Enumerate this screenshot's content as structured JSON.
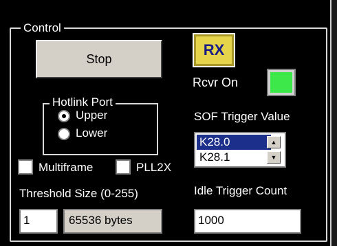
{
  "control": {
    "group_title": "Control",
    "stop_label": "Stop",
    "rx_label": "RX",
    "rcvr_label": "Rcvr On",
    "rcvr_led_color": "#3ce84a",
    "hotlink": {
      "title": "Hotlink Port",
      "options": [
        "Upper",
        "Lower"
      ],
      "selected": "Upper"
    },
    "sof": {
      "title": "SOF Trigger  Value",
      "items": [
        "K28.0",
        "K28.1"
      ],
      "selected": "K28.0"
    },
    "multiframe_label": "Multiframe",
    "multiframe_checked": false,
    "pll_label": "PLL2X",
    "pll_checked": false,
    "threshold": {
      "label": "Threshold Size (0-255)",
      "value": "1",
      "bytes": "65536 bytes"
    },
    "idle": {
      "label": "Idle Trigger Count",
      "value": "1000"
    }
  }
}
